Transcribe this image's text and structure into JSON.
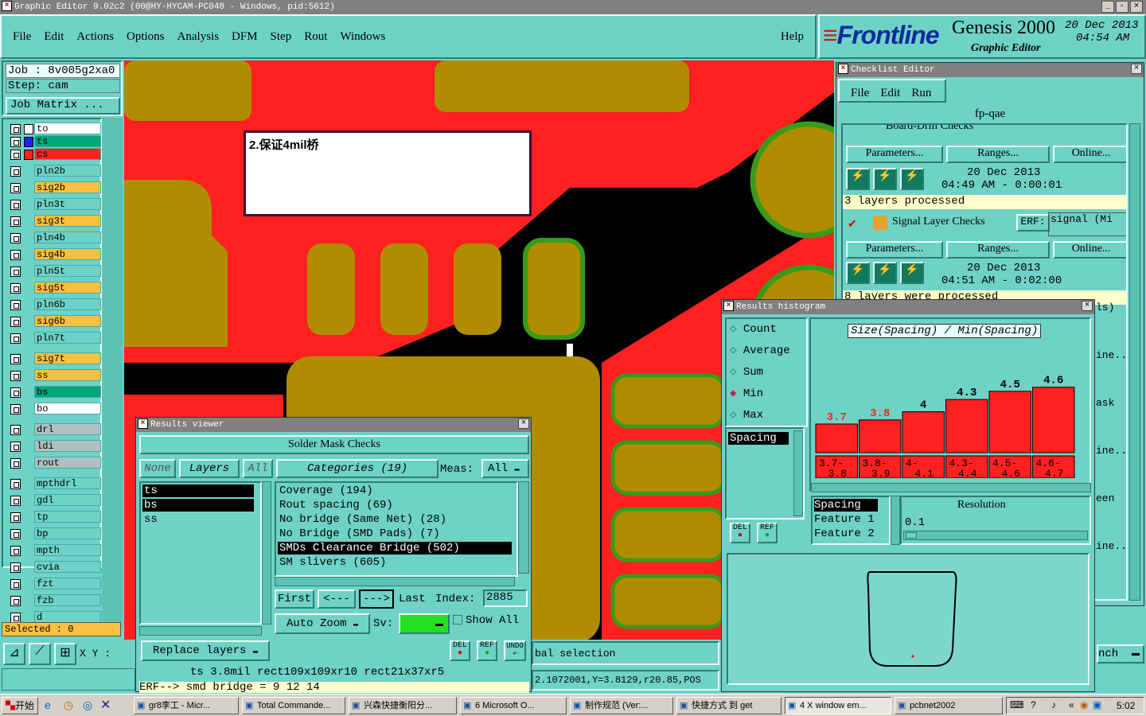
{
  "window": {
    "title": "Graphic Editor 9.02c2  (00@HY-HYCAM-PC048 - Windows, pid:5612)"
  },
  "menubar": [
    "File",
    "Edit",
    "Actions",
    "Options",
    "Analysis",
    "DFM",
    "Step",
    "Rout",
    "Windows"
  ],
  "help": "Help",
  "brand": {
    "logo": "Frontline",
    "product": "Genesis 2000",
    "subtitle": "Graphic Editor",
    "date": "20 Dec 2013",
    "time": "04:54 AM"
  },
  "job": {
    "job_label": "Job : 8v005g2xa0",
    "step_label": "Step:  cam",
    "matrix_btn": "Job Matrix ..."
  },
  "layers": [
    {
      "name": "to",
      "color": "#ffffff"
    },
    {
      "name": "ts",
      "color": "#00a87a"
    },
    {
      "name": "cs",
      "color": "#ff2020"
    },
    {
      "name": "pln2b",
      "color": "#6fd2c6"
    },
    {
      "name": "sig2b",
      "color": "#ffbf3f"
    },
    {
      "name": "pln3t",
      "color": "#6fd2c6"
    },
    {
      "name": "sig3t",
      "color": "#ffbf3f"
    },
    {
      "name": "pln4b",
      "color": "#6fd2c6"
    },
    {
      "name": "sig4b",
      "color": "#ffbf3f"
    },
    {
      "name": "pln5t",
      "color": "#6fd2c6"
    },
    {
      "name": "sig5t",
      "color": "#ffbf3f"
    },
    {
      "name": "pln6b",
      "color": "#6fd2c6"
    },
    {
      "name": "sig6b",
      "color": "#ffbf3f"
    },
    {
      "name": "pln7t",
      "color": "#6fd2c6"
    },
    {
      "name": "sig7t",
      "color": "#ffbf3f"
    },
    {
      "name": "ss",
      "color": "#ffbf3f"
    },
    {
      "name": "bs",
      "color": "#00a87a"
    },
    {
      "name": "bo",
      "color": "#ffffff"
    },
    {
      "name": "drl",
      "color": "#b0c0c0"
    },
    {
      "name": "ldi",
      "color": "#b0c0c0"
    },
    {
      "name": "rout",
      "color": "#b0c0c0"
    },
    {
      "name": "mpthdrl",
      "color": "#6fd2c6"
    },
    {
      "name": "gdl",
      "color": "#6fd2c6"
    },
    {
      "name": "tp",
      "color": "#6fd2c6"
    },
    {
      "name": "bp",
      "color": "#6fd2c6"
    },
    {
      "name": "mpth",
      "color": "#6fd2c6"
    },
    {
      "name": "cvia",
      "color": "#6fd2c6"
    },
    {
      "name": "fzt",
      "color": "#6fd2c6"
    },
    {
      "name": "fzb",
      "color": "#6fd2c6"
    },
    {
      "name": "d",
      "color": "#6fd2c6"
    }
  ],
  "selected": "Selected : 0",
  "xy_label": "X Y :",
  "note": "2.保证4mil桥",
  "checklist": {
    "title": "Checklist Editor",
    "menu": [
      "File",
      "Edit",
      "Run"
    ],
    "name": "fp-qae",
    "row0": "Board-Drill Checks",
    "erf_label": "ERF:",
    "params": "Parameters...",
    "ranges": "Ranges...",
    "online": "Online...",
    "a": {
      "date": "20 Dec 2013",
      "range": "04:49 AM - 0:00:01",
      "status": "3 layers processed"
    },
    "b": {
      "name": "Signal Layer Checks",
      "erf_value": "signal (Mi",
      "date": "20 Dec 2013",
      "range": "04:51 AM - 0:02:00",
      "status": "8 layers were processed"
    },
    "right_labels": [
      "ls)",
      "ine...",
      "ask",
      "ine...",
      "een",
      "ine..."
    ]
  },
  "histogram": {
    "title": "Results histogram",
    "modes": [
      "Count",
      "Average",
      "Sum",
      "Min",
      "Max"
    ],
    "selected_mode": "Min",
    "measure": "Spacing",
    "chart_title": "Size(Spacing) / Min(Spacing)",
    "del": "DEL",
    "ref": "REF",
    "list": [
      "Spacing",
      "Feature 1",
      "Feature 2"
    ],
    "resolution_label": "Resolution",
    "resolution_value": "0.1"
  },
  "chart_data": {
    "type": "bar",
    "title": "Size(Spacing) / Min(Spacing)",
    "categories": [
      "3.7-3.8",
      "3.8-3.9",
      "4-4.1",
      "4.3-4.4",
      "4.5-4.6",
      "4.6-4.7"
    ],
    "cat_lines": [
      [
        "3.7-",
        "3.8"
      ],
      [
        "3.8-",
        "3.9"
      ],
      [
        "4-",
        "4.1"
      ],
      [
        "4.3-",
        "4.4"
      ],
      [
        "4.5-",
        "4.6"
      ],
      [
        "4.6-",
        "4.7"
      ]
    ],
    "labels": [
      "3.7",
      "3.8",
      "4",
      "4.3",
      "4.5",
      "4.6"
    ],
    "values": [
      3.7,
      3.8,
      4,
      4.3,
      4.5,
      4.6
    ],
    "label_colors": [
      "#ff2020",
      "#ff2020",
      "#000000",
      "#000000",
      "#000000",
      "#000000"
    ]
  },
  "results": {
    "title": "Results viewer",
    "header": "Solder Mask Checks",
    "none": "None",
    "layers_label": "Layers",
    "all": "All",
    "categories_label": "Categories (19)",
    "meas_label": "Meas:",
    "meas_value": "All",
    "layer_items": [
      "ts",
      "bs",
      "ss"
    ],
    "categories": [
      "Coverage (194)",
      "Rout spacing (69)",
      "No bridge (Same Net) (28)",
      "No Bridge (SMD Pads) (7)",
      "SMDs Clearance Bridge (502)",
      "SM slivers (605)"
    ],
    "nav": {
      "first": "First",
      "prev": "<---",
      "next": "--->",
      "last": "Last",
      "index_label": "Index:",
      "index_value": "2885"
    },
    "auto_zoom": "Auto Zoom",
    "sv_label": "Sv:",
    "show_all": "Show All",
    "replace": "Replace layers",
    "del": "DEL",
    "ref": "REF",
    "undo": "UNDO"
  },
  "status": {
    "measure": "ts 3.8mil   rect109x109xr10   rect21x37xr5",
    "erf": "ERF--> smd bridge = 9 12 14",
    "selection": "bal selection",
    "coords": "2.1072001,Y=3.8129,r20.85,POS",
    "inch": "nch"
  },
  "taskbar": {
    "start": "开始",
    "items": [
      "gr8李工 - Micr...",
      "Total Commande...",
      "兴森快捷衡阳分...",
      "6 Microsoft O...",
      "制作规范 (Ver:...",
      "快捷方式 到 get",
      "4 X window em...",
      "pcbnet2002"
    ],
    "clock": "5:02"
  }
}
